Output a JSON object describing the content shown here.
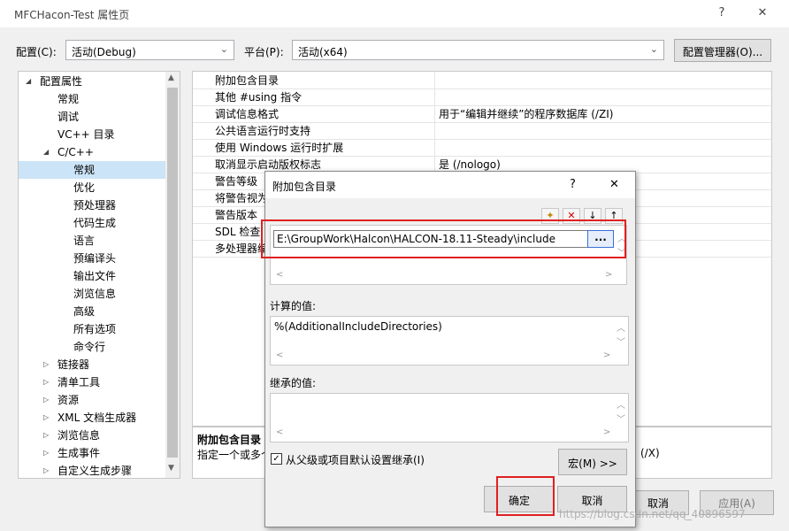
{
  "window": {
    "title": "MFCHacon-Test 属性页",
    "help": "?",
    "close": "✕"
  },
  "config": {
    "config_label": "配置(C):",
    "config_value": "活动(Debug)",
    "platform_label": "平台(P):",
    "platform_value": "活动(x64)",
    "manager_button": "配置管理器(O)..."
  },
  "tree": {
    "items": [
      {
        "label": "配置属性",
        "expander": "◢"
      },
      {
        "label": "常规"
      },
      {
        "label": "调试"
      },
      {
        "label": "VC++ 目录"
      },
      {
        "label": "C/C++",
        "expander": "◢"
      },
      {
        "label": "常规"
      },
      {
        "label": "优化"
      },
      {
        "label": "预处理器"
      },
      {
        "label": "代码生成"
      },
      {
        "label": "语言"
      },
      {
        "label": "预编译头"
      },
      {
        "label": "输出文件"
      },
      {
        "label": "浏览信息"
      },
      {
        "label": "高级"
      },
      {
        "label": "所有选项"
      },
      {
        "label": "命令行"
      },
      {
        "label": "链接器",
        "expander": "▷"
      },
      {
        "label": "清单工具",
        "expander": "▷"
      },
      {
        "label": "资源",
        "expander": "▷"
      },
      {
        "label": "XML 文档生成器",
        "expander": "▷"
      },
      {
        "label": "浏览信息",
        "expander": "▷"
      },
      {
        "label": "生成事件",
        "expander": "▷"
      },
      {
        "label": "自定义生成步骤",
        "expander": "▷"
      }
    ]
  },
  "grid": {
    "rows": [
      {
        "name": "附加包含目录",
        "value": ""
      },
      {
        "name": "其他 #using 指令",
        "value": ""
      },
      {
        "name": "调试信息格式",
        "value": "用于“编辑并继续”的程序数据库 (/ZI)"
      },
      {
        "name": "公共语言运行时支持",
        "value": ""
      },
      {
        "name": "使用 Windows 运行时扩展",
        "value": ""
      },
      {
        "name": "取消显示启动版权标志",
        "value": "是 (/nologo)"
      },
      {
        "name": "警告等级",
        "value": ""
      },
      {
        "name": "将警告视为",
        "value": ""
      },
      {
        "name": "警告版本",
        "value": ""
      },
      {
        "name": "SDL 检查",
        "value": ""
      },
      {
        "name": "多处理器编",
        "value": ""
      }
    ]
  },
  "description": {
    "title": "附加包含目录",
    "text": "指定一个或多个"
  },
  "main_buttons": {
    "cancel": "取消",
    "apply": "应用(A)",
    "partial_right": "(/X)"
  },
  "dialog": {
    "title": "附加包含目录",
    "help": "?",
    "close": "✕",
    "toolbar": {
      "new": "✦",
      "delete": "✕",
      "down": "↓",
      "up": "↑"
    },
    "include_path": "E:\\GroupWork\\Halcon\\HALCON-18.11-Steady\\include",
    "browse_button": "...",
    "computed_label": "计算的值:",
    "computed_value": "%(AdditionalIncludeDirectories)",
    "inherited_label": "继承的值:",
    "inherit_checkbox": "从父级或项目默认设置继承(I)",
    "macro_button": "宏(M) >>",
    "ok_button": "确定",
    "cancel_button": "取消"
  },
  "watermark": "https://blog.csdn.net/qq_40896597"
}
